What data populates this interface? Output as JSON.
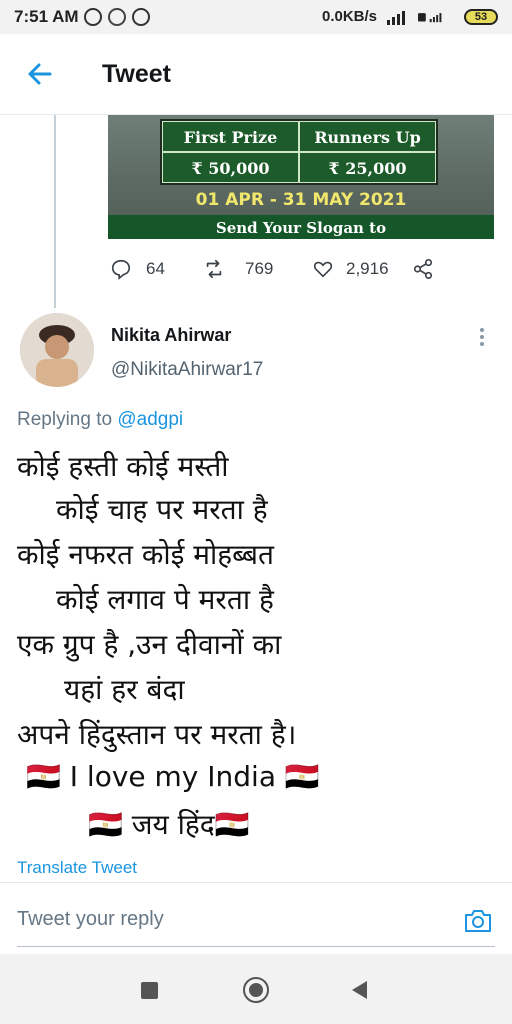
{
  "status_bar": {
    "time": "7:51 AM",
    "net_speed": "0.0KB/s",
    "battery": "53"
  },
  "header": {
    "title": "Tweet"
  },
  "previous_tweet": {
    "card": {
      "col1_header": "First Prize",
      "col2_header": "Runners Up",
      "col1_value": "₹ 50,000",
      "col2_value": "₹ 25,000",
      "dates": "01 APR - 31 MAY 2021",
      "footer": "Send Your Slogan to"
    },
    "actions": {
      "replies": "64",
      "retweets": "769",
      "likes": "2,916"
    }
  },
  "reply": {
    "name": "Nikita Ahirwar",
    "handle": "@NikitaAhirwar17",
    "replying_prefix": "Replying to ",
    "replying_to": "@adgpi",
    "lines": [
      "कोई हस्ती कोई मस्ती",
      "कोई चाह पर मरता है",
      "कोई नफरत कोई मोहब्बत",
      "कोई लगाव पे मरता है",
      "एक ग्रुप है ,उन दीवानों का",
      "यहां हर बंदा",
      "अपने हिंदुस्तान पर मरता है।",
      "🇪🇬 I love my India 🇪🇬",
      "🇪🇬 जय हिंद🇪🇬"
    ],
    "translate": "Translate Tweet"
  },
  "reply_box": {
    "placeholder": "Tweet your reply"
  },
  "colors": {
    "accent": "#1b95e0",
    "card_green": "#1d5b2a"
  }
}
